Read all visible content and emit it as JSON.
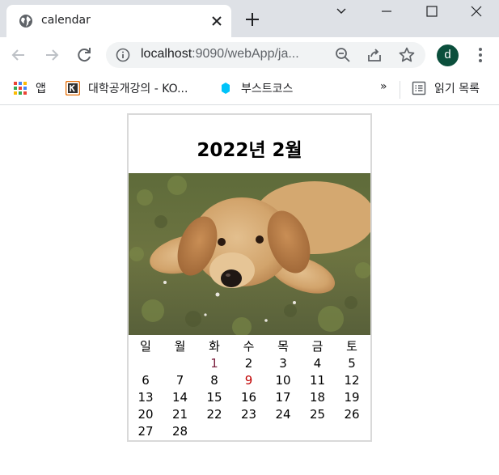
{
  "browser": {
    "tab_title": "calendar",
    "url_host": "localhost",
    "url_path": ":9090/webApp/ja...",
    "avatar_letter": "d",
    "bookmarks": [
      {
        "label": "앱",
        "icon": "apps-grid-icon"
      },
      {
        "label": "대학공개강의 - KO...",
        "icon": "kocw-k-icon"
      },
      {
        "label": "부스트코스",
        "icon": "boostcourse-icon"
      }
    ],
    "overflow_label": "»",
    "reading_list_label": "읽기 목록"
  },
  "calendar": {
    "title": "2022년 2월",
    "weekdays": [
      "일",
      "월",
      "화",
      "수",
      "목",
      "금",
      "토"
    ],
    "weeks": [
      [
        "",
        "",
        "1",
        "2",
        "3",
        "4",
        "5"
      ],
      [
        "6",
        "7",
        "8",
        "9",
        "10",
        "11",
        "12"
      ],
      [
        "13",
        "14",
        "15",
        "16",
        "17",
        "18",
        "19"
      ],
      [
        "20",
        "21",
        "22",
        "23",
        "24",
        "25",
        "26"
      ],
      [
        "27",
        "28",
        "",
        "",
        "",
        "",
        ""
      ]
    ],
    "highlight_day": "9",
    "highlight_color": "#c00000",
    "first_day_color": "#7a1f3d",
    "photo_subject": "golden retriever puppy lying on grass"
  },
  "colors": {
    "tabstrip": "#dee1e6",
    "omnibox": "#f1f3f4",
    "avatar": "#0b4f3c",
    "calendar_border": "#d9d9d9"
  }
}
